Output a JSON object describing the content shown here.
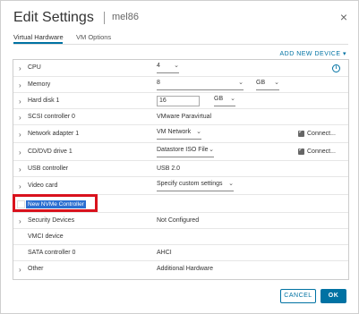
{
  "dialog": {
    "title": "Edit Settings",
    "subtitle": "mel86",
    "close_icon": "×"
  },
  "tabs": [
    {
      "label": "Virtual Hardware",
      "active": true
    },
    {
      "label": "VM Options",
      "active": false
    }
  ],
  "add_device_label": "ADD NEW DEVICE ▾",
  "rows": {
    "cpu": {
      "label": "CPU",
      "value": "4"
    },
    "memory": {
      "label": "Memory",
      "value": "8",
      "unit": "GB"
    },
    "hard_disk": {
      "label": "Hard disk 1",
      "value": "16",
      "unit": "GB"
    },
    "scsi": {
      "label": "SCSI controller 0",
      "value": "VMware Paravirtual"
    },
    "network": {
      "label": "Network adapter 1",
      "value": "VM Network",
      "checkbox_label": "Connect..."
    },
    "cddvd": {
      "label": "CD/DVD drive 1",
      "value": "Datastore ISO File",
      "checkbox_label": "Connect..."
    },
    "usb": {
      "label": "USB controller",
      "value": "USB 2.0"
    },
    "video": {
      "label": "Video card",
      "value": "Specify custom settings"
    },
    "nvme": {
      "label": "New NVMe Controller"
    },
    "security": {
      "label": "Security Devices",
      "value": "Not Configured"
    },
    "vmci": {
      "label": "VMCI device"
    },
    "sata": {
      "label": "SATA controller 0",
      "value": "AHCI"
    },
    "other": {
      "label": "Other",
      "value": "Additional Hardware"
    }
  },
  "buttons": {
    "cancel": "CANCEL",
    "ok": "OK"
  },
  "colors": {
    "accent": "#0072a3",
    "highlight_box": "#d9121d",
    "selection": "#2c6fd1"
  }
}
